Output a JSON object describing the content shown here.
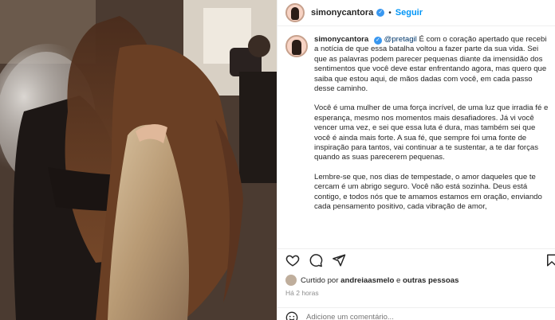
{
  "header": {
    "username": "simonycantora",
    "verified_mark": "✓",
    "separator": "•",
    "follow_label": "Seguir"
  },
  "caption": {
    "username": "simonycantora",
    "mention": "@pretagil",
    "p1": "É com o coração apertado que recebi a notícia de que essa batalha voltou a fazer parte da sua vida. Sei que as palavras podem parecer pequenas diante da imensidão dos sentimentos que você deve estar enfrentando agora, mas quero que saiba que estou aqui, de mãos dadas com você, em cada passo desse caminho.",
    "p2": "Você é uma mulher de uma força incrível, de uma luz que irradia fé e esperança, mesmo nos momentos mais desafiadores. Já vi você vencer uma vez, e sei que essa luta é dura, mas também sei que você é ainda mais forte. A sua fé, que sempre foi uma fonte de inspiração para tantos, vai continuar a te sustentar, a te dar forças quando as suas parecerem pequenas.",
    "p3": "Lembre-se que, nos dias de tempestade, o amor daqueles que te cercam é um abrigo seguro. Você não está sozinha. Deus está contigo, e todos nós que te amamos estamos em oração, enviando cada pensamento positivo, cada vibração de amor,"
  },
  "likes": {
    "prefix": "Curtido por",
    "user": "andreiaasmelo",
    "connector": "e",
    "others": "outras pessoas"
  },
  "timestamp": "Há 2 horas",
  "comment_input": {
    "placeholder": "Adicione um comentário..."
  },
  "icons": {
    "like": "heart-icon",
    "comment": "comment-icon",
    "share": "share-icon",
    "save": "bookmark-icon",
    "emoji": "emoji-icon"
  },
  "colors": {
    "accent": "#0095f6",
    "verified": "#3897f0",
    "mention": "#00376b",
    "muted": "#8e8e8e"
  }
}
